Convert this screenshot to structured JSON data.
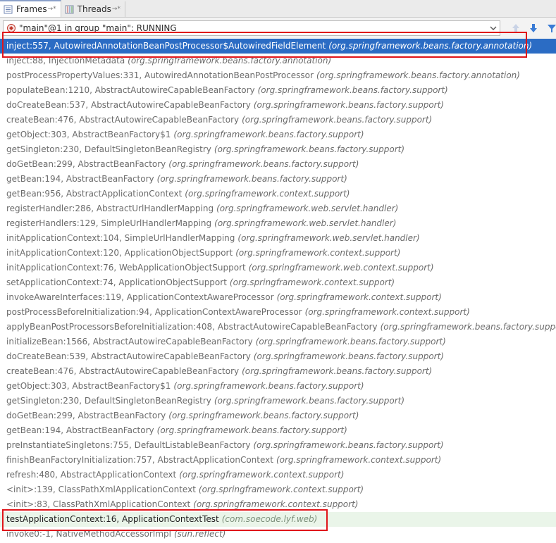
{
  "tabs": [
    {
      "label": "Frames",
      "suffix": "→*",
      "active": true
    },
    {
      "label": "Threads",
      "suffix": "→*",
      "active": false
    }
  ],
  "thread_selector": {
    "value": "\"main\"@1 in group \"main\": RUNNING"
  },
  "frames": [
    {
      "method": "inject:557, AutowiredAnnotationBeanPostProcessor$AutowiredFieldElement",
      "package": "(org.springframework.beans.factory.annotation)"
    },
    {
      "method": "inject:88, InjectionMetadata",
      "package": "(org.springframework.beans.factory.annotation)"
    },
    {
      "method": "postProcessPropertyValues:331, AutowiredAnnotationBeanPostProcessor",
      "package": "(org.springframework.beans.factory.annotation)"
    },
    {
      "method": "populateBean:1210, AbstractAutowireCapableBeanFactory",
      "package": "(org.springframework.beans.factory.support)"
    },
    {
      "method": "doCreateBean:537, AbstractAutowireCapableBeanFactory",
      "package": "(org.springframework.beans.factory.support)"
    },
    {
      "method": "createBean:476, AbstractAutowireCapableBeanFactory",
      "package": "(org.springframework.beans.factory.support)"
    },
    {
      "method": "getObject:303, AbstractBeanFactory$1",
      "package": "(org.springframework.beans.factory.support)"
    },
    {
      "method": "getSingleton:230, DefaultSingletonBeanRegistry",
      "package": "(org.springframework.beans.factory.support)"
    },
    {
      "method": "doGetBean:299, AbstractBeanFactory",
      "package": "(org.springframework.beans.factory.support)"
    },
    {
      "method": "getBean:194, AbstractBeanFactory",
      "package": "(org.springframework.beans.factory.support)"
    },
    {
      "method": "getBean:956, AbstractApplicationContext",
      "package": "(org.springframework.context.support)"
    },
    {
      "method": "registerHandler:286, AbstractUrlHandlerMapping",
      "package": "(org.springframework.web.servlet.handler)"
    },
    {
      "method": "registerHandlers:129, SimpleUrlHandlerMapping",
      "package": "(org.springframework.web.servlet.handler)"
    },
    {
      "method": "initApplicationContext:104, SimpleUrlHandlerMapping",
      "package": "(org.springframework.web.servlet.handler)"
    },
    {
      "method": "initApplicationContext:120, ApplicationObjectSupport",
      "package": "(org.springframework.context.support)"
    },
    {
      "method": "initApplicationContext:76, WebApplicationObjectSupport",
      "package": "(org.springframework.web.context.support)"
    },
    {
      "method": "setApplicationContext:74, ApplicationObjectSupport",
      "package": "(org.springframework.context.support)"
    },
    {
      "method": "invokeAwareInterfaces:119, ApplicationContextAwareProcessor",
      "package": "(org.springframework.context.support)"
    },
    {
      "method": "postProcessBeforeInitialization:94, ApplicationContextAwareProcessor",
      "package": "(org.springframework.context.support)"
    },
    {
      "method": "applyBeanPostProcessorsBeforeInitialization:408, AbstractAutowireCapableBeanFactory",
      "package": "(org.springframework.beans.factory.support)"
    },
    {
      "method": "initializeBean:1566, AbstractAutowireCapableBeanFactory",
      "package": "(org.springframework.beans.factory.support)"
    },
    {
      "method": "doCreateBean:539, AbstractAutowireCapableBeanFactory",
      "package": "(org.springframework.beans.factory.support)"
    },
    {
      "method": "createBean:476, AbstractAutowireCapableBeanFactory",
      "package": "(org.springframework.beans.factory.support)"
    },
    {
      "method": "getObject:303, AbstractBeanFactory$1",
      "package": "(org.springframework.beans.factory.support)"
    },
    {
      "method": "getSingleton:230, DefaultSingletonBeanRegistry",
      "package": "(org.springframework.beans.factory.support)"
    },
    {
      "method": "doGetBean:299, AbstractBeanFactory",
      "package": "(org.springframework.beans.factory.support)"
    },
    {
      "method": "getBean:194, AbstractBeanFactory",
      "package": "(org.springframework.beans.factory.support)"
    },
    {
      "method": "preInstantiateSingletons:755, DefaultListableBeanFactory",
      "package": "(org.springframework.beans.factory.support)"
    },
    {
      "method": "finishBeanFactoryInitialization:757, AbstractApplicationContext",
      "package": "(org.springframework.context.support)"
    },
    {
      "method": "refresh:480, AbstractApplicationContext",
      "package": "(org.springframework.context.support)"
    },
    {
      "method": "<init>:139, ClassPathXmlApplicationContext",
      "package": "(org.springframework.context.support)"
    },
    {
      "method": "<init>:83, ClassPathXmlApplicationContext",
      "package": "(org.springframework.context.support)"
    },
    {
      "method": "testApplicationContext:16, ApplicationContextTest",
      "package": "(com.soecode.lyf.web)"
    },
    {
      "method": "invoke0:-1, NativeMethodAccessorImpl",
      "package": "(sun.reflect)"
    }
  ],
  "selected_index": 0,
  "user_frame_index": 32,
  "colors": {
    "selection": "#2b6cc4",
    "user_frame_bg": "#eaf5e9",
    "highlight_box": "#e0151a"
  }
}
